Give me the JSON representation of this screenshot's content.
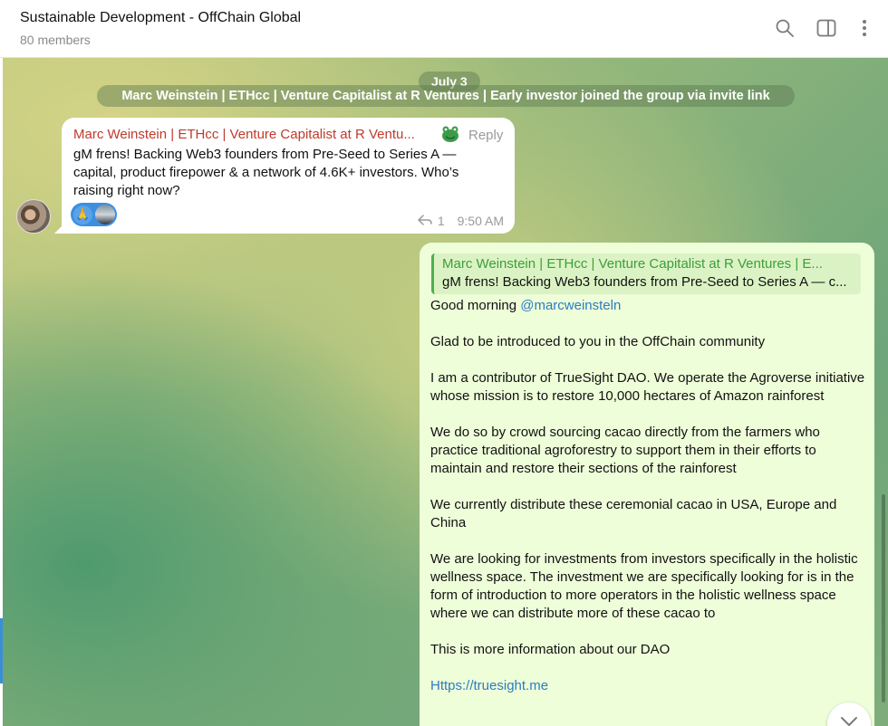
{
  "header": {
    "title": "Sustainable Development - OffChain Global",
    "members": "80 members",
    "icons": [
      "search-icon",
      "sidebar-toggle-icon",
      "more-vertical-icon"
    ]
  },
  "chat": {
    "date_pill": "July 3",
    "service_message": "Marc Weinstein | ETHcc | Venture Capitalist at R Ventures | Early investor joined the group via invite link",
    "incoming": {
      "sender": "Marc Weinstein | ETHcc | Venture Capitalist at R Ventu...",
      "reply_label": "Reply",
      "text": "gM frens! Backing Web3 founders from Pre-Seed to Series A — capital, product firepower & a network of 4.6K+ investors. Who’s raising right now?",
      "reaction_emoji": "🙏",
      "reply_count": "1",
      "time": "9:50 AM"
    },
    "outgoing": {
      "quote_name": "Marc Weinstein | ETHcc | Venture Capitalist at R Ventures | E...",
      "quote_text": "gM frens! Backing Web3 founders from Pre-Seed to Series A — c...",
      "greeting": "Good morning",
      "mention": "@marcweinsteln",
      "paragraphs": [
        "Glad to be introduced to you in the OffChain community",
        "I am a contributor of TrueSight DAO. We operate the Agroverse initiative whose mission is to restore 10,000 hectares of Amazon rainforest",
        "We do so by crowd sourcing cacao directly from the farmers who practice traditional agroforestry to support them in their efforts to maintain and restore their sections of the rainforest",
        "We currently distribute these ceremonial cacao in USA, Europe and China",
        "We are looking for investments from investors specifically in the holistic wellness space. The investment we are specifically looking for is in the form of introduction to more operators in the holistic wellness space where we can distribute more of these cacao to",
        "This is more information about our DAO"
      ],
      "link": "Https://truesight.me"
    }
  },
  "colors": {
    "sender_name": "#c03a2b",
    "quote_name": "#3e9d3a",
    "link": "#2d7bc1",
    "outgoing_bubble": "#eefed9"
  }
}
